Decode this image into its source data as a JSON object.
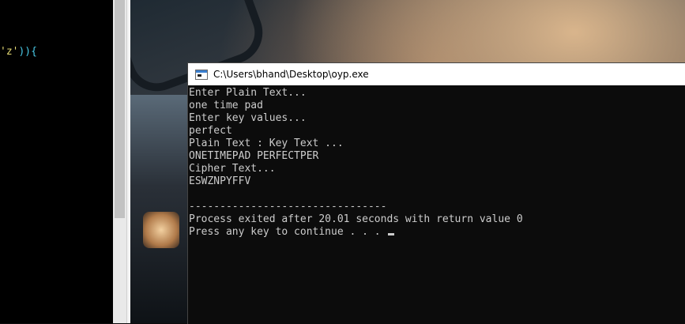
{
  "editor": {
    "code_str": "'z'",
    "code_punc": ")){"
  },
  "console": {
    "title": "C:\\Users\\bhand\\Desktop\\oyp.exe",
    "lines": [
      "Enter Plain Text...",
      "one time pad",
      "Enter key values...",
      "perfect",
      "Plain Text : Key Text ...",
      "ONETIMEPAD PERFECTPER",
      "Cipher Text...",
      "ESWZNPYFFV",
      "",
      "--------------------------------",
      "Process exited after 20.01 seconds with return value 0",
      "Press any key to continue . . . "
    ]
  },
  "colors": {
    "console_bg": "#0c0c0c",
    "console_text": "#cccccc",
    "string_token": "#e6db74",
    "punct_token": "#49c9e6"
  },
  "icons": {
    "console_app": "console-window-icon"
  }
}
